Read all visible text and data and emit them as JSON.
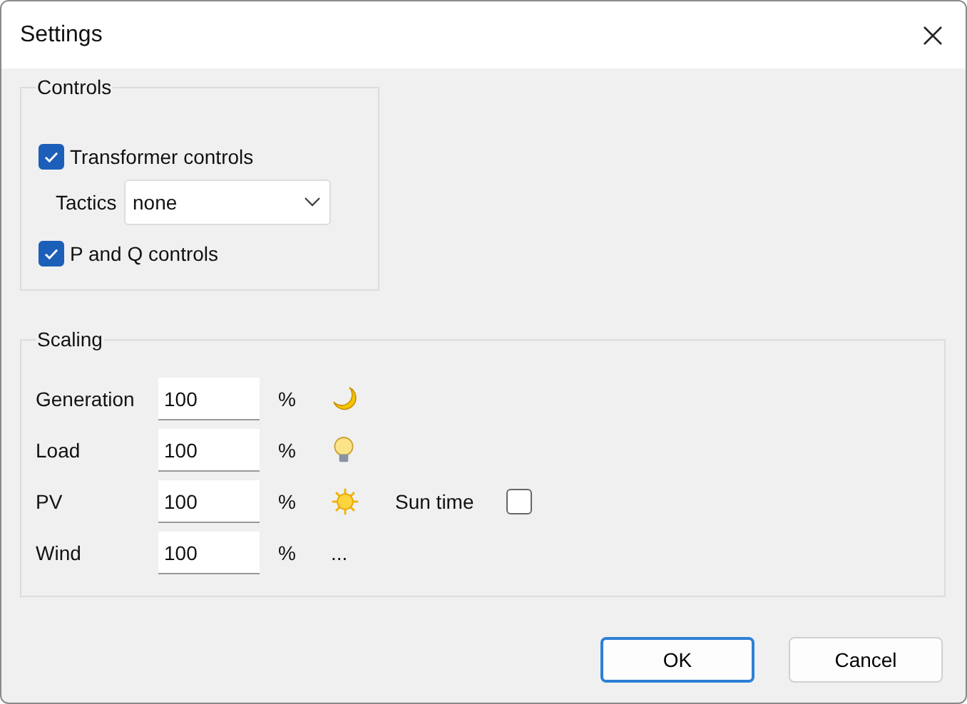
{
  "window": {
    "title": "Settings"
  },
  "controls": {
    "legend": "Controls",
    "transformer": {
      "label": "Transformer controls",
      "checked": true
    },
    "tactics": {
      "label": "Tactics",
      "value": "none"
    },
    "pq": {
      "label": "P and Q controls",
      "checked": true
    }
  },
  "scaling": {
    "legend": "Scaling",
    "rows": [
      {
        "label": "Generation",
        "value": "100",
        "unit": "%",
        "kind": "moon"
      },
      {
        "label": "Load",
        "value": "100",
        "unit": "%",
        "kind": "bulb"
      },
      {
        "label": "PV",
        "value": "100",
        "unit": "%",
        "kind": "sun",
        "option": {
          "label": "Sun time",
          "checked": false
        }
      },
      {
        "label": "Wind",
        "value": "100",
        "unit": "%",
        "kind": "text",
        "note": "..."
      }
    ]
  },
  "buttons": [
    {
      "label": "OK",
      "default": true
    },
    {
      "label": "Cancel",
      "default": false
    }
  ]
}
